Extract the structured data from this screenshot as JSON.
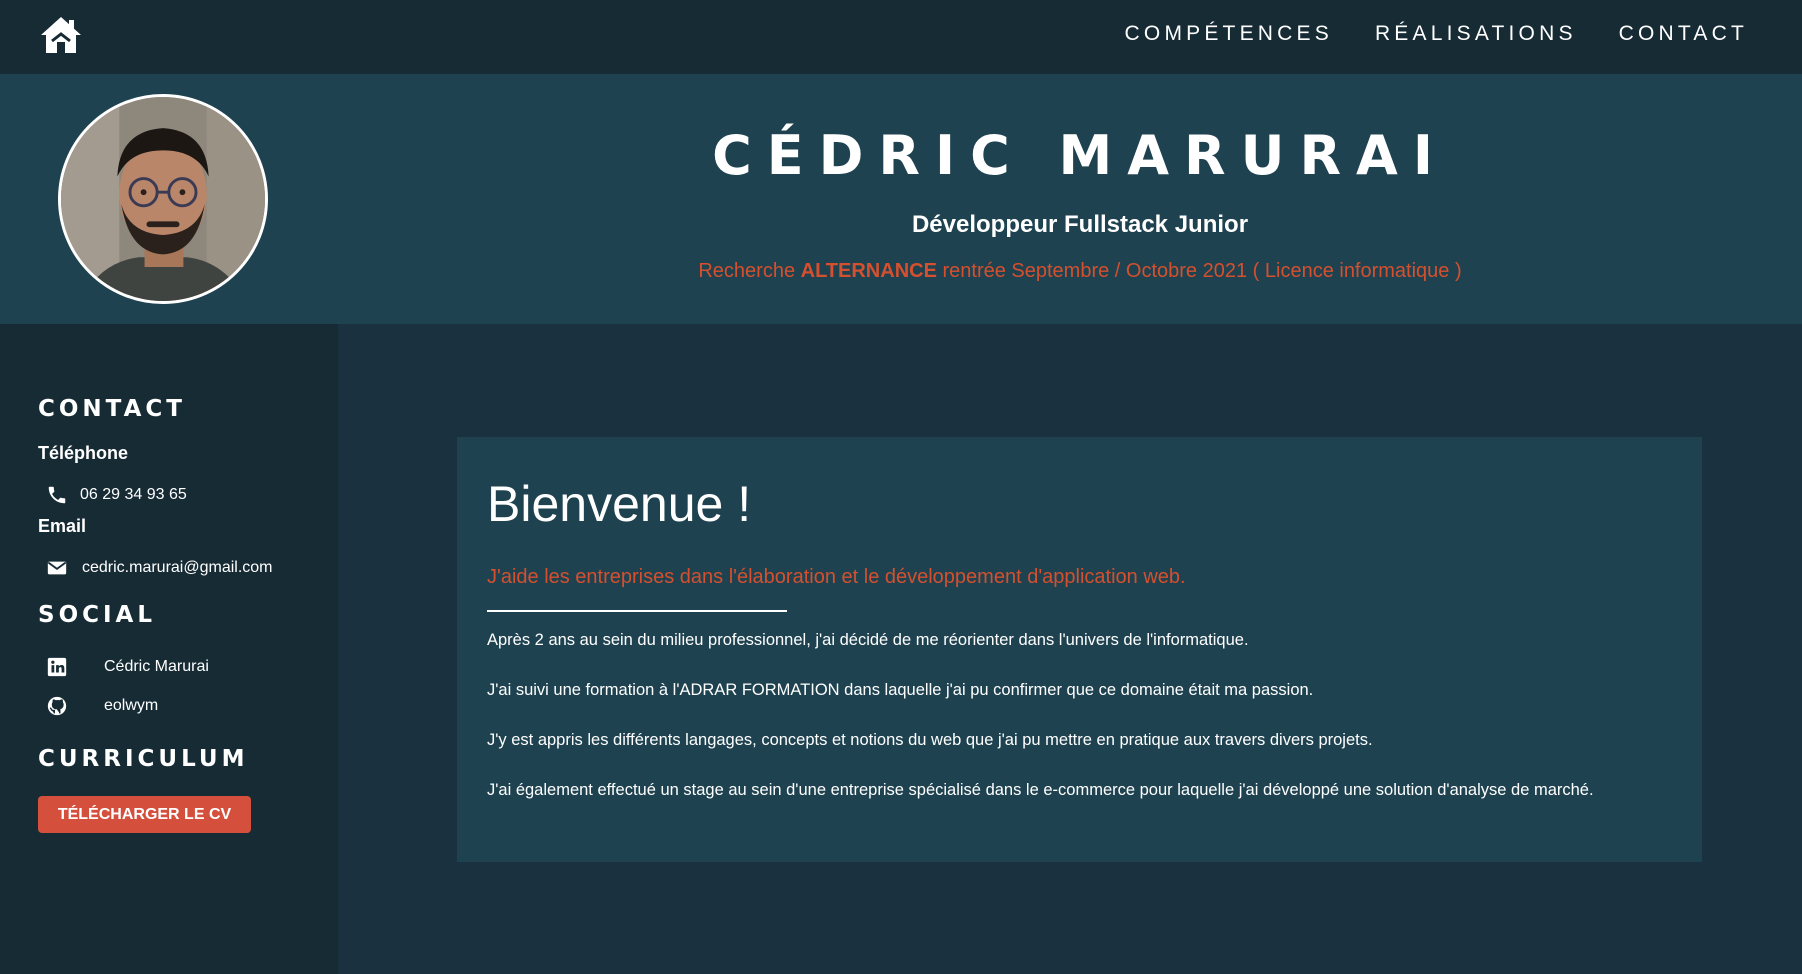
{
  "navbar": {
    "home_icon": "home-icon",
    "links": [
      "COMPÉTENCES",
      "RÉALISATIONS",
      "CONTACT"
    ]
  },
  "header": {
    "name": "CÉDRIC MARURAI",
    "title": "Développeur Fullstack Junior",
    "search_prefix": "Recherche",
    "search_highlight": "ALTERNANCE",
    "search_suffix": "rentrée Septembre / Octobre 2021 ( Licence informatique )"
  },
  "sidebar": {
    "contact_heading": "CONTACT",
    "phone_label": "Téléphone",
    "phone_value": "06 29 34 93 65",
    "email_label": "Email",
    "email_value": "cedric.marurai@gmail.com",
    "social_heading": "SOCIAL",
    "linkedin_name": "Cédric Marurai",
    "github_name": "eolwym",
    "curriculum_heading": "CURRICULUM",
    "cv_button": "TÉLÉCHARGER LE CV"
  },
  "main": {
    "title": "Bienvenue !",
    "subtitle": "J'aide les entreprises dans l'élaboration et le développement d'application web.",
    "paragraphs": [
      "Après 2 ans au sein du milieu professionnel, j'ai décidé de me réorienter dans l'univers de l'informatique.",
      "J'ai suivi une formation à l'ADRAR FORMATION dans laquelle j'ai pu confirmer que ce domaine était ma passion.",
      "J'y est appris les différents langages, concepts et notions du web que j'ai pu mettre en pratique aux travers divers projets.",
      "J'ai également effectué un stage au sein d'une entreprise spécialisé dans le e-commerce pour laquelle j'ai développé une solution d'analyse de marché."
    ]
  },
  "colors": {
    "background": "#1a323f",
    "navbar": "#172b35",
    "header": "#1e4250",
    "accent": "#d4502e",
    "button": "#d4503d"
  }
}
